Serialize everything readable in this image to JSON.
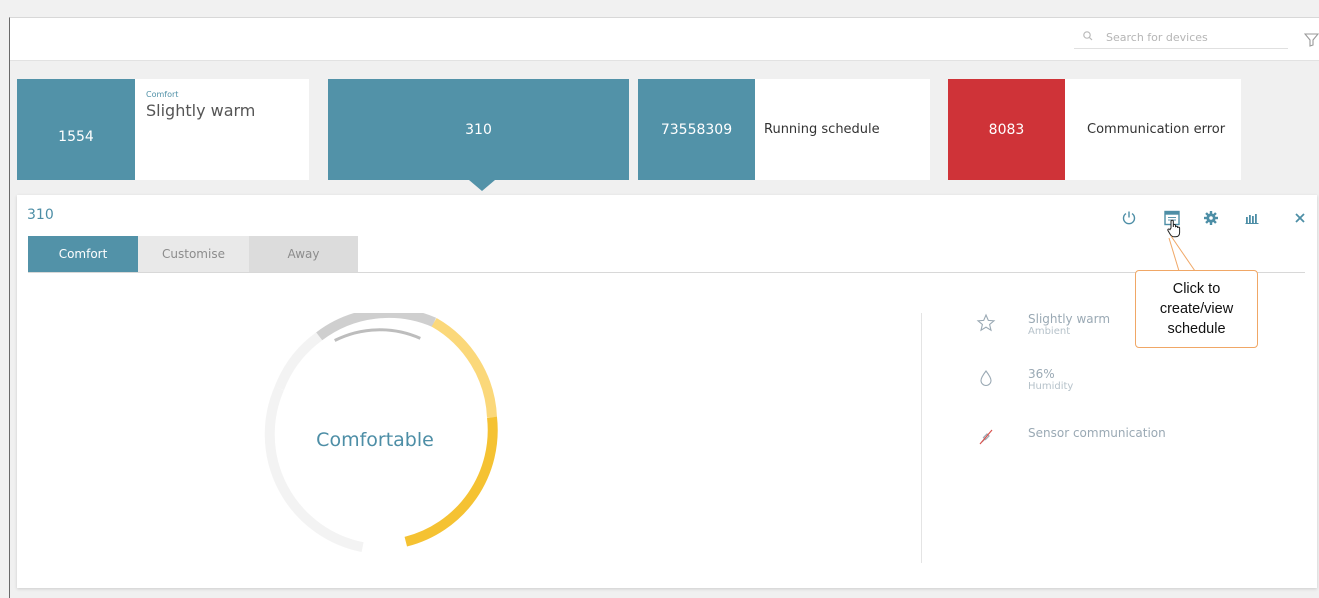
{
  "search": {
    "placeholder": "Search for devices"
  },
  "tiles": [
    {
      "id": "1554",
      "category": "Comfort",
      "status": "Slightly warm",
      "color": "#5292a8"
    },
    {
      "id": "310",
      "selected": true,
      "color": "#5292a8"
    },
    {
      "id": "73558309",
      "status": "Running schedule",
      "color": "#5292a8"
    },
    {
      "id": "8083",
      "status": "Communication error",
      "color": "#cf3338"
    }
  ],
  "panel": {
    "title": "310",
    "tabs": [
      {
        "label": "Comfort",
        "active": true
      },
      {
        "label": "Customise",
        "active": false
      },
      {
        "label": "Away",
        "active": false
      }
    ],
    "toolbar": [
      "power-icon",
      "calendar-icon",
      "gear-icon",
      "chart-icon",
      "close-icon"
    ],
    "gauge": {
      "label": "Comfortable"
    },
    "details": [
      {
        "icon": "star-icon",
        "value": "Slightly warm",
        "label": "Ambient"
      },
      {
        "icon": "droplet-icon",
        "value": "36%",
        "label": "Humidity"
      },
      {
        "icon": "sensor-off-icon",
        "value": "Sensor communication",
        "label": ""
      }
    ]
  },
  "callout": {
    "line1": "Click to",
    "line2": "create/view",
    "line3": "schedule"
  },
  "colors": {
    "accent": "#5292a8",
    "error": "#cf3338",
    "gauge_warm": "#f5c232",
    "gauge_light": "#fbd87a",
    "gauge_grey": "#cfcfcf"
  }
}
